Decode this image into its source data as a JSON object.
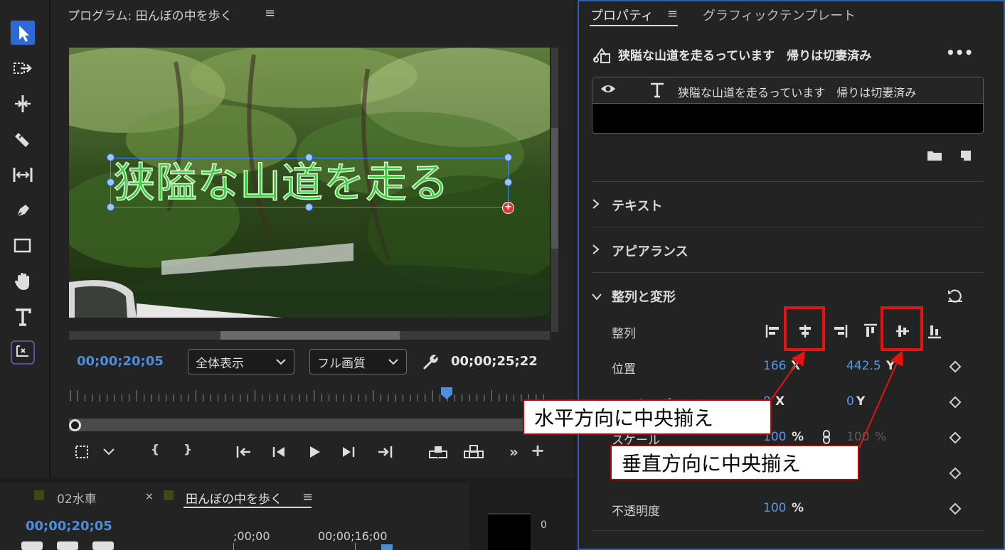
{
  "program_monitor": {
    "title": "プログラム: 田んぼの中を歩く",
    "menu_icon": "hamburger-icon",
    "overlay_text": "狭隘な山道を走る",
    "timecode_current": "00;00;20;05",
    "zoom_select": "全体表示",
    "quality_select": "フル画質",
    "timecode_duration": "00;00;25;22"
  },
  "toolbar": {
    "tools": [
      "selection-tool",
      "track-select-tool",
      "ripple-edit-tool",
      "razor-tool",
      "slip-tool",
      "pen-tool",
      "rectangle-tool",
      "hand-tool",
      "type-tool",
      "auto-reframe-tool"
    ]
  },
  "properties": {
    "tab_properties": "プロパティ",
    "tab_templates": "グラフィックテンプレート",
    "clip_title": "狭隘な山道を走るっています　帰りは切妻済み",
    "layer_name": "狭隘な山道を走るっています　帰りは切妻済み",
    "sections": {
      "text": "テキスト",
      "appearance": "アピアランス",
      "align_transform": "整列と変形"
    },
    "align_label": "整列",
    "position": {
      "label": "位置",
      "x": "166",
      "x_axis": "X",
      "y": "442.5",
      "y_axis": "Y"
    },
    "anchor": {
      "label": "アンカーポイント",
      "x": "0",
      "x_axis": "X",
      "y": "0",
      "y_axis": "Y"
    },
    "scale": {
      "label": "スケール",
      "value": "100",
      "unit": "%",
      "linked_value": "100",
      "linked_unit": "%"
    },
    "opacity": {
      "label": "不透明度",
      "value": "100",
      "unit": "%"
    }
  },
  "timeline": {
    "tab_inactive": "02水車",
    "tab_close": "×",
    "tab_active": "田んぼの中を歩く",
    "timecode": "00;00;20;05",
    "ruler_start": ";00;00",
    "ruler_mid": "00;00;16;00",
    "meter_zero": "0"
  },
  "annotations": {
    "horizontal": "水平方向に中央揃え",
    "vertical": "垂直方向に中央揃え"
  },
  "colors": {
    "accent_blue": "#4d8ee0",
    "annotation_red": "#e81212",
    "panel_bg": "#232323"
  }
}
